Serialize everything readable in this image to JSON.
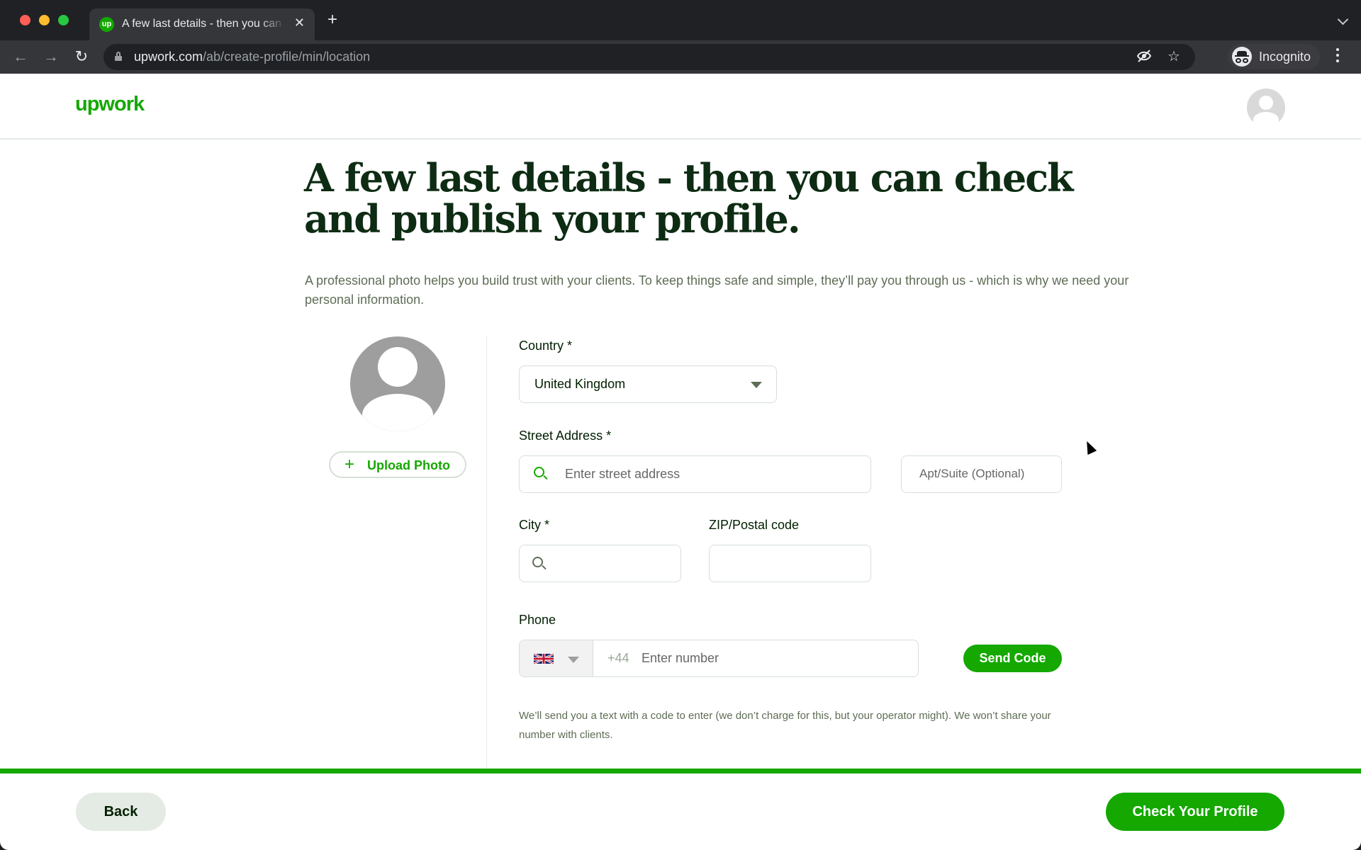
{
  "browser": {
    "tab_title": "A few last details - then you can check and publish your profile.",
    "tab_favicon_text": "up",
    "url_domain": "upwork.com",
    "url_path": "/ab/create-profile/min/location",
    "profile_label": "Incognito",
    "icons": {
      "back": "arrow-left-icon",
      "forward": "arrow-right-icon",
      "reload": "reload-icon",
      "lock": "lock-icon",
      "eye_off": "eye-off-icon",
      "bookmark": "star-icon",
      "media": "media-control-icon",
      "incognito": "incognito-icon",
      "menu": "kebab-menu-icon"
    }
  },
  "header": {
    "logo": "upwork"
  },
  "main": {
    "title": "A few last details - then you can check and publish your profile.",
    "description": "A professional photo helps you build trust with your clients. To keep things safe and simple, they’ll pay you through us - which is why we need your personal information.",
    "upload_photo_label": "Upload Photo"
  },
  "form": {
    "country": {
      "label": "Country *",
      "value": "United Kingdom"
    },
    "street": {
      "label": "Street Address *",
      "placeholder": "Enter street address"
    },
    "apt": {
      "placeholder": "Apt/Suite (Optional)"
    },
    "city": {
      "label": "City *",
      "value": ""
    },
    "zip": {
      "label": "ZIP/Postal code",
      "value": ""
    },
    "phone": {
      "label": "Phone",
      "country_flag": "united-kingdom-flag",
      "prefix": "+44",
      "placeholder": "Enter number",
      "send_code_label": "Send Code"
    },
    "help_text": "We’ll send you a text with a code to enter (we don’t charge for this, but your operator might). We won’t share your number with clients."
  },
  "progress": {
    "percent": 100
  },
  "footer": {
    "back_label": "Back",
    "next_label": "Check Your Profile"
  },
  "colors": {
    "brand_green": "#14a800",
    "title_dark": "#0d2c13",
    "muted_text": "#5e6d55"
  }
}
